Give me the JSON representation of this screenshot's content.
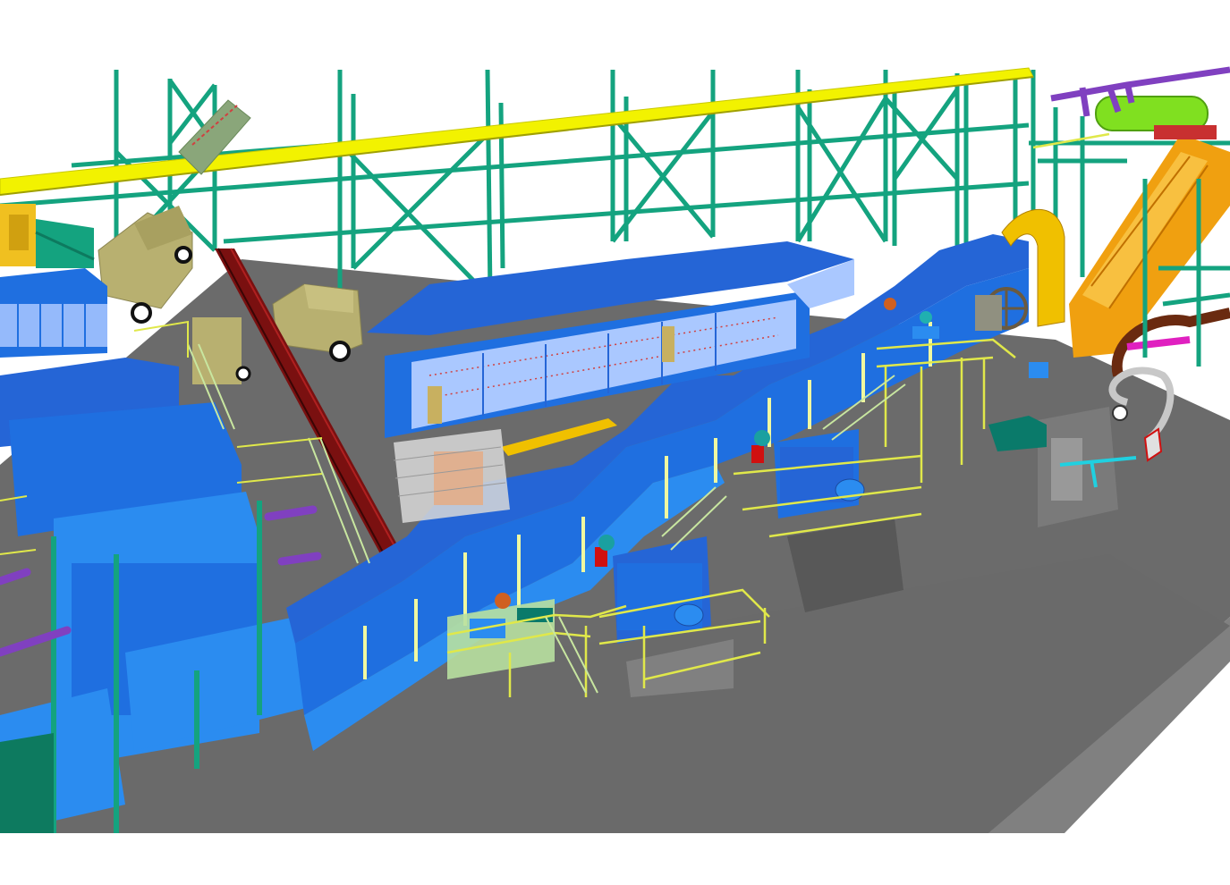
{
  "scene": {
    "kind": "3d-cad-plant-render",
    "palette": {
      "background": "#ffffff",
      "floor": "#6b6b6b",
      "floor_dark": "#4a4a4a",
      "floor_side": "#808080",
      "steel_frame": "#14a37f",
      "steel_frame_dark": "#0d7a5f",
      "crane_rail": "#f2f200",
      "duct_blue": "#1f6fe0",
      "duct_blue_light": "#2b8cf0",
      "duct_blue_top": "#2565d6",
      "handrail": "#e0e84a",
      "stair_pale": "#c8e6a0",
      "conveyor_red": "#7a1010",
      "motor_teal": "#0a7a6a",
      "chute_orange": "#f0a010",
      "chute_orange_light": "#f8c040",
      "pipe_purple": "#8040c0",
      "pipe_magenta": "#e020c0",
      "tank_green": "#80e020",
      "pipe_yellow": "#f0c000",
      "pipe_cyan": "#20d0e0",
      "pipe_brown": "#6a2a10",
      "vehicle_khaki": "#b8b070",
      "window_glass": "#aac8ff",
      "marker_red": "#d01010",
      "silver": "#c8c8c8"
    },
    "icons": [
      "steel-column-icon",
      "crane-rail-icon",
      "blue-duct-icon",
      "motor-icon",
      "handrail-icon",
      "belt-conveyor-icon",
      "orange-chute-icon",
      "green-tank-icon",
      "pipe-loop-icon",
      "truck-icon"
    ]
  }
}
